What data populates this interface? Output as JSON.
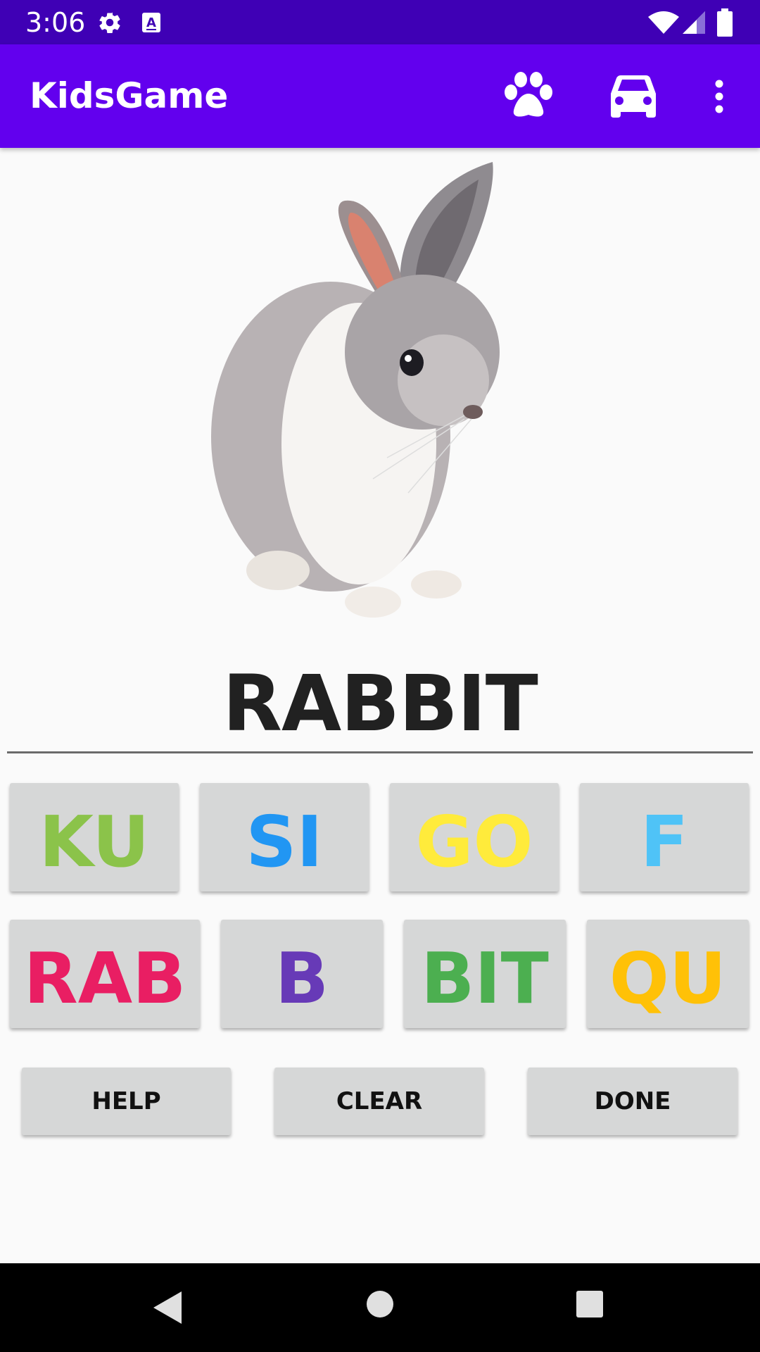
{
  "status_bar": {
    "time": "3:06",
    "icons": [
      "gear-icon",
      "keyboard-a-icon",
      "wifi-icon",
      "signal-icon",
      "battery-icon"
    ]
  },
  "app_bar": {
    "title": "KidsGame",
    "actions": [
      "paw-icon",
      "car-icon",
      "more-vert-icon"
    ]
  },
  "colors": {
    "status_bar": "#3f00b5",
    "app_bar": "#6200ee",
    "tile_bg": "#d6d7d7"
  },
  "picture": {
    "subject": "rabbit"
  },
  "word": "RABBIT",
  "syllable_tiles_row1": [
    {
      "text": "KU",
      "color": "#8bc34a"
    },
    {
      "text": "SI",
      "color": "#2196f3"
    },
    {
      "text": "GO",
      "color": "#ffeb3b"
    },
    {
      "text": "F",
      "color": "#4fc3f7"
    }
  ],
  "syllable_tiles_row2": [
    {
      "text": "RAB",
      "color": "#e91e63"
    },
    {
      "text": "B",
      "color": "#673ab7"
    },
    {
      "text": "BIT",
      "color": "#4caf50"
    },
    {
      "text": "QU",
      "color": "#ffc107"
    }
  ],
  "buttons": {
    "help": "HELP",
    "clear": "CLEAR",
    "done": "DONE"
  },
  "nav_bar": [
    "back-icon",
    "home-icon",
    "recents-icon"
  ]
}
